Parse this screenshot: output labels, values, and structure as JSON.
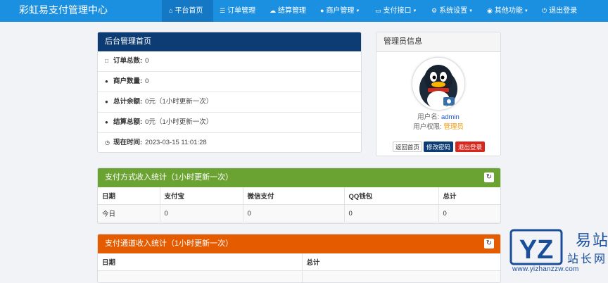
{
  "navbar": {
    "brand": "彩虹易支付管理中心",
    "items": [
      {
        "label": "平台首页",
        "icon": "home-icon",
        "caret": false,
        "active": true
      },
      {
        "label": "订单管理",
        "icon": "list-icon",
        "caret": false
      },
      {
        "label": "结算管理",
        "icon": "cloud-icon",
        "caret": false
      },
      {
        "label": "商户管理",
        "icon": "user-icon",
        "caret": true
      },
      {
        "label": "支付接口",
        "icon": "credit-card-icon",
        "caret": true
      },
      {
        "label": "系统设置",
        "icon": "gear-icon",
        "caret": true
      },
      {
        "label": "其他功能",
        "icon": "globe-icon",
        "caret": true
      },
      {
        "label": "退出登录",
        "icon": "power-icon",
        "caret": false
      }
    ]
  },
  "home_panel": {
    "title": "后台管理首页",
    "stats": [
      {
        "icon": "bar-chart-icon",
        "label": "订单总数:",
        "value": "0"
      },
      {
        "icon": "drop-icon",
        "label": "商户数量:",
        "value": "0"
      },
      {
        "icon": "drop-icon",
        "label": "总计余额:",
        "value": "0元（1小时更新一次）"
      },
      {
        "icon": "drop-icon",
        "label": "结算总额:",
        "value": "0元（1小时更新一次）"
      },
      {
        "icon": "clock-icon",
        "label": "现在时间:",
        "value": "2023-03-15 11:01:28"
      }
    ]
  },
  "admin_panel": {
    "title": "管理员信息",
    "username_label": "用户名:",
    "username": "admin",
    "role_label": "用户权限:",
    "role": "管理员",
    "buttons": {
      "back": "返回首页",
      "change_password": "修改密码",
      "logout": "退出登录"
    }
  },
  "pay_method_stats": {
    "title": "支付方式收入统计（1小时更新一次）",
    "columns": [
      "日期",
      "支付宝",
      "微信支付",
      "QQ钱包",
      "总计"
    ],
    "rows": [
      [
        "今日",
        "0",
        "0",
        "0",
        "0"
      ]
    ]
  },
  "pay_channel_stats": {
    "title": "支付通道收入统计（1小时更新一次）",
    "columns": [
      "日期",
      "总计"
    ]
  },
  "watermark": {
    "logo_text": "YZ",
    "chars": [
      "易",
      "站",
      "站",
      "长",
      "网"
    ],
    "url": "www.yizhanzzw.com"
  },
  "colors": {
    "navbar": "#1b8fe0",
    "navy": "#0c3c73",
    "green": "#6ba333",
    "orange": "#e55b00",
    "red": "#d9261c"
  }
}
